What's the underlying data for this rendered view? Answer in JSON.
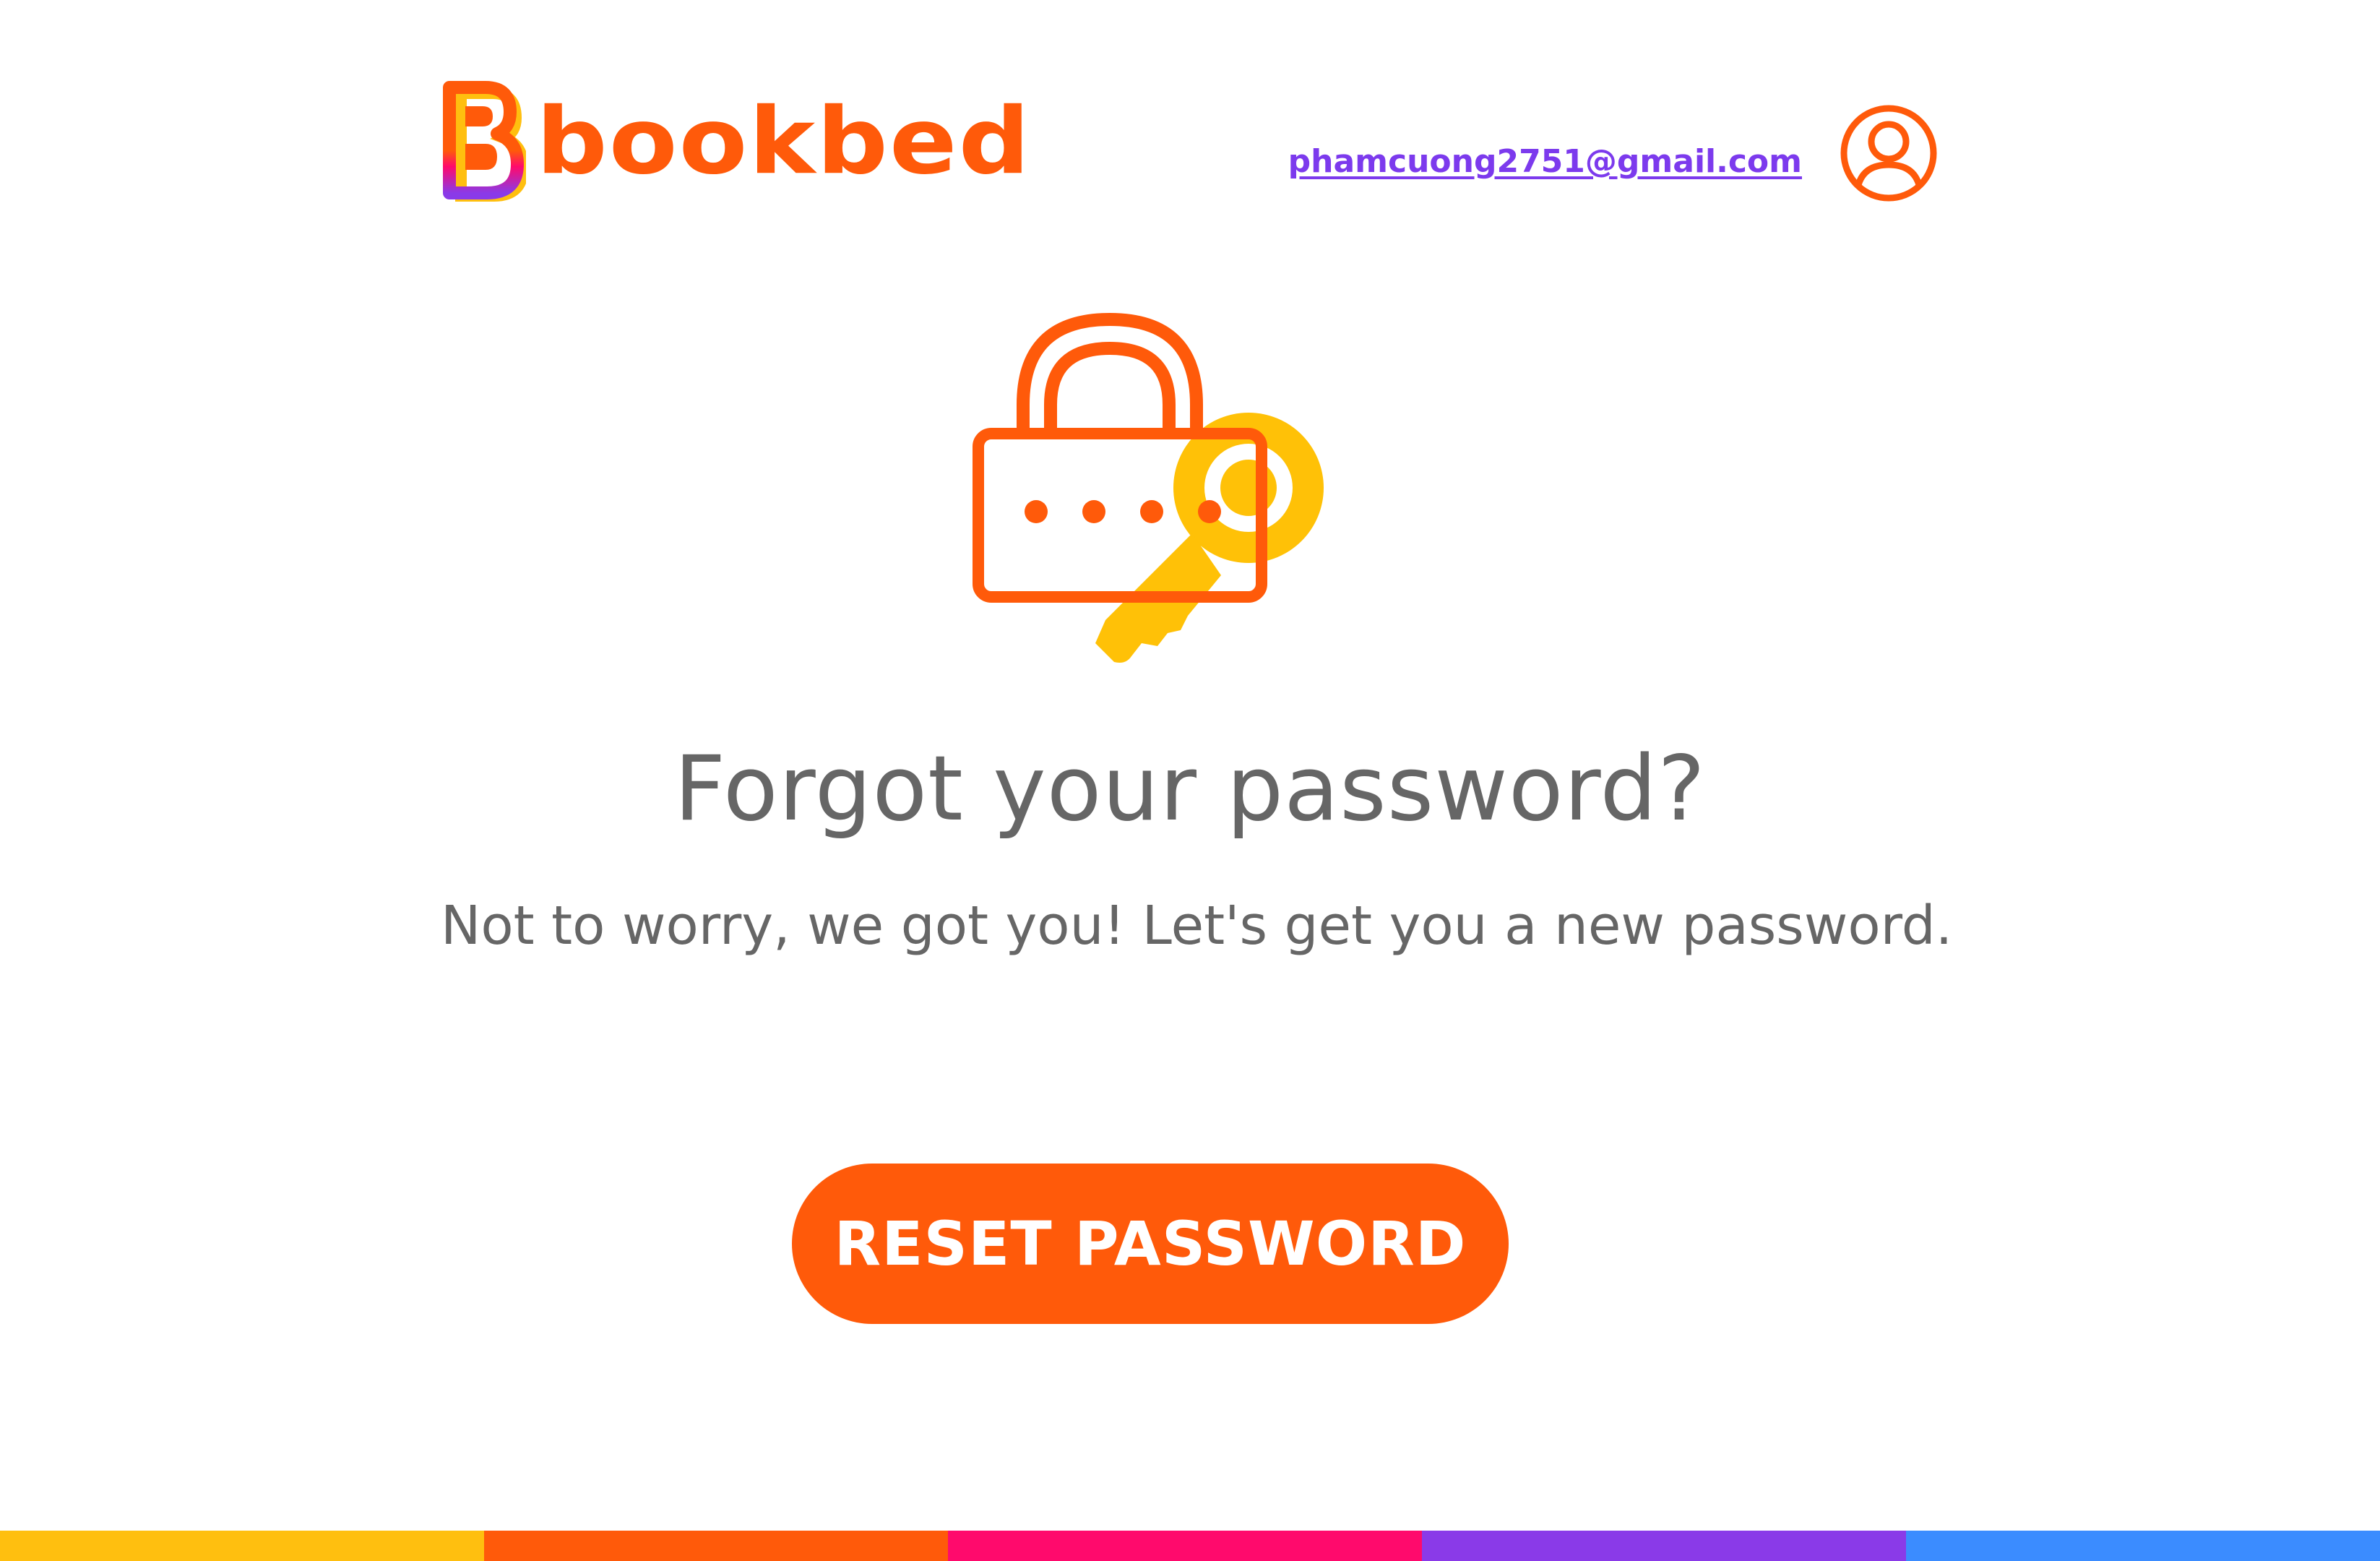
{
  "header": {
    "logo_text": "bookbed",
    "user_email": "phamcuong2751@gmail.com"
  },
  "main": {
    "headline": "Forgot your password?",
    "subtext": "Not to worry, we got you! Let's get you a new password.",
    "reset_button_label": "RESET PASSWORD"
  },
  "colors": {
    "brand_orange": "#ff5a0a",
    "key_yellow": "#ffc107",
    "link_purple": "#7c3aed",
    "text_gray": "#666666"
  },
  "footer": {
    "color_bar": [
      "#ffbf0f",
      "#ff5a0a",
      "#ff0a6c",
      "#8a3ae8",
      "#3b8cff"
    ]
  },
  "icons": {
    "avatar": "user-circle-icon",
    "hero": "lock-key-icon"
  }
}
